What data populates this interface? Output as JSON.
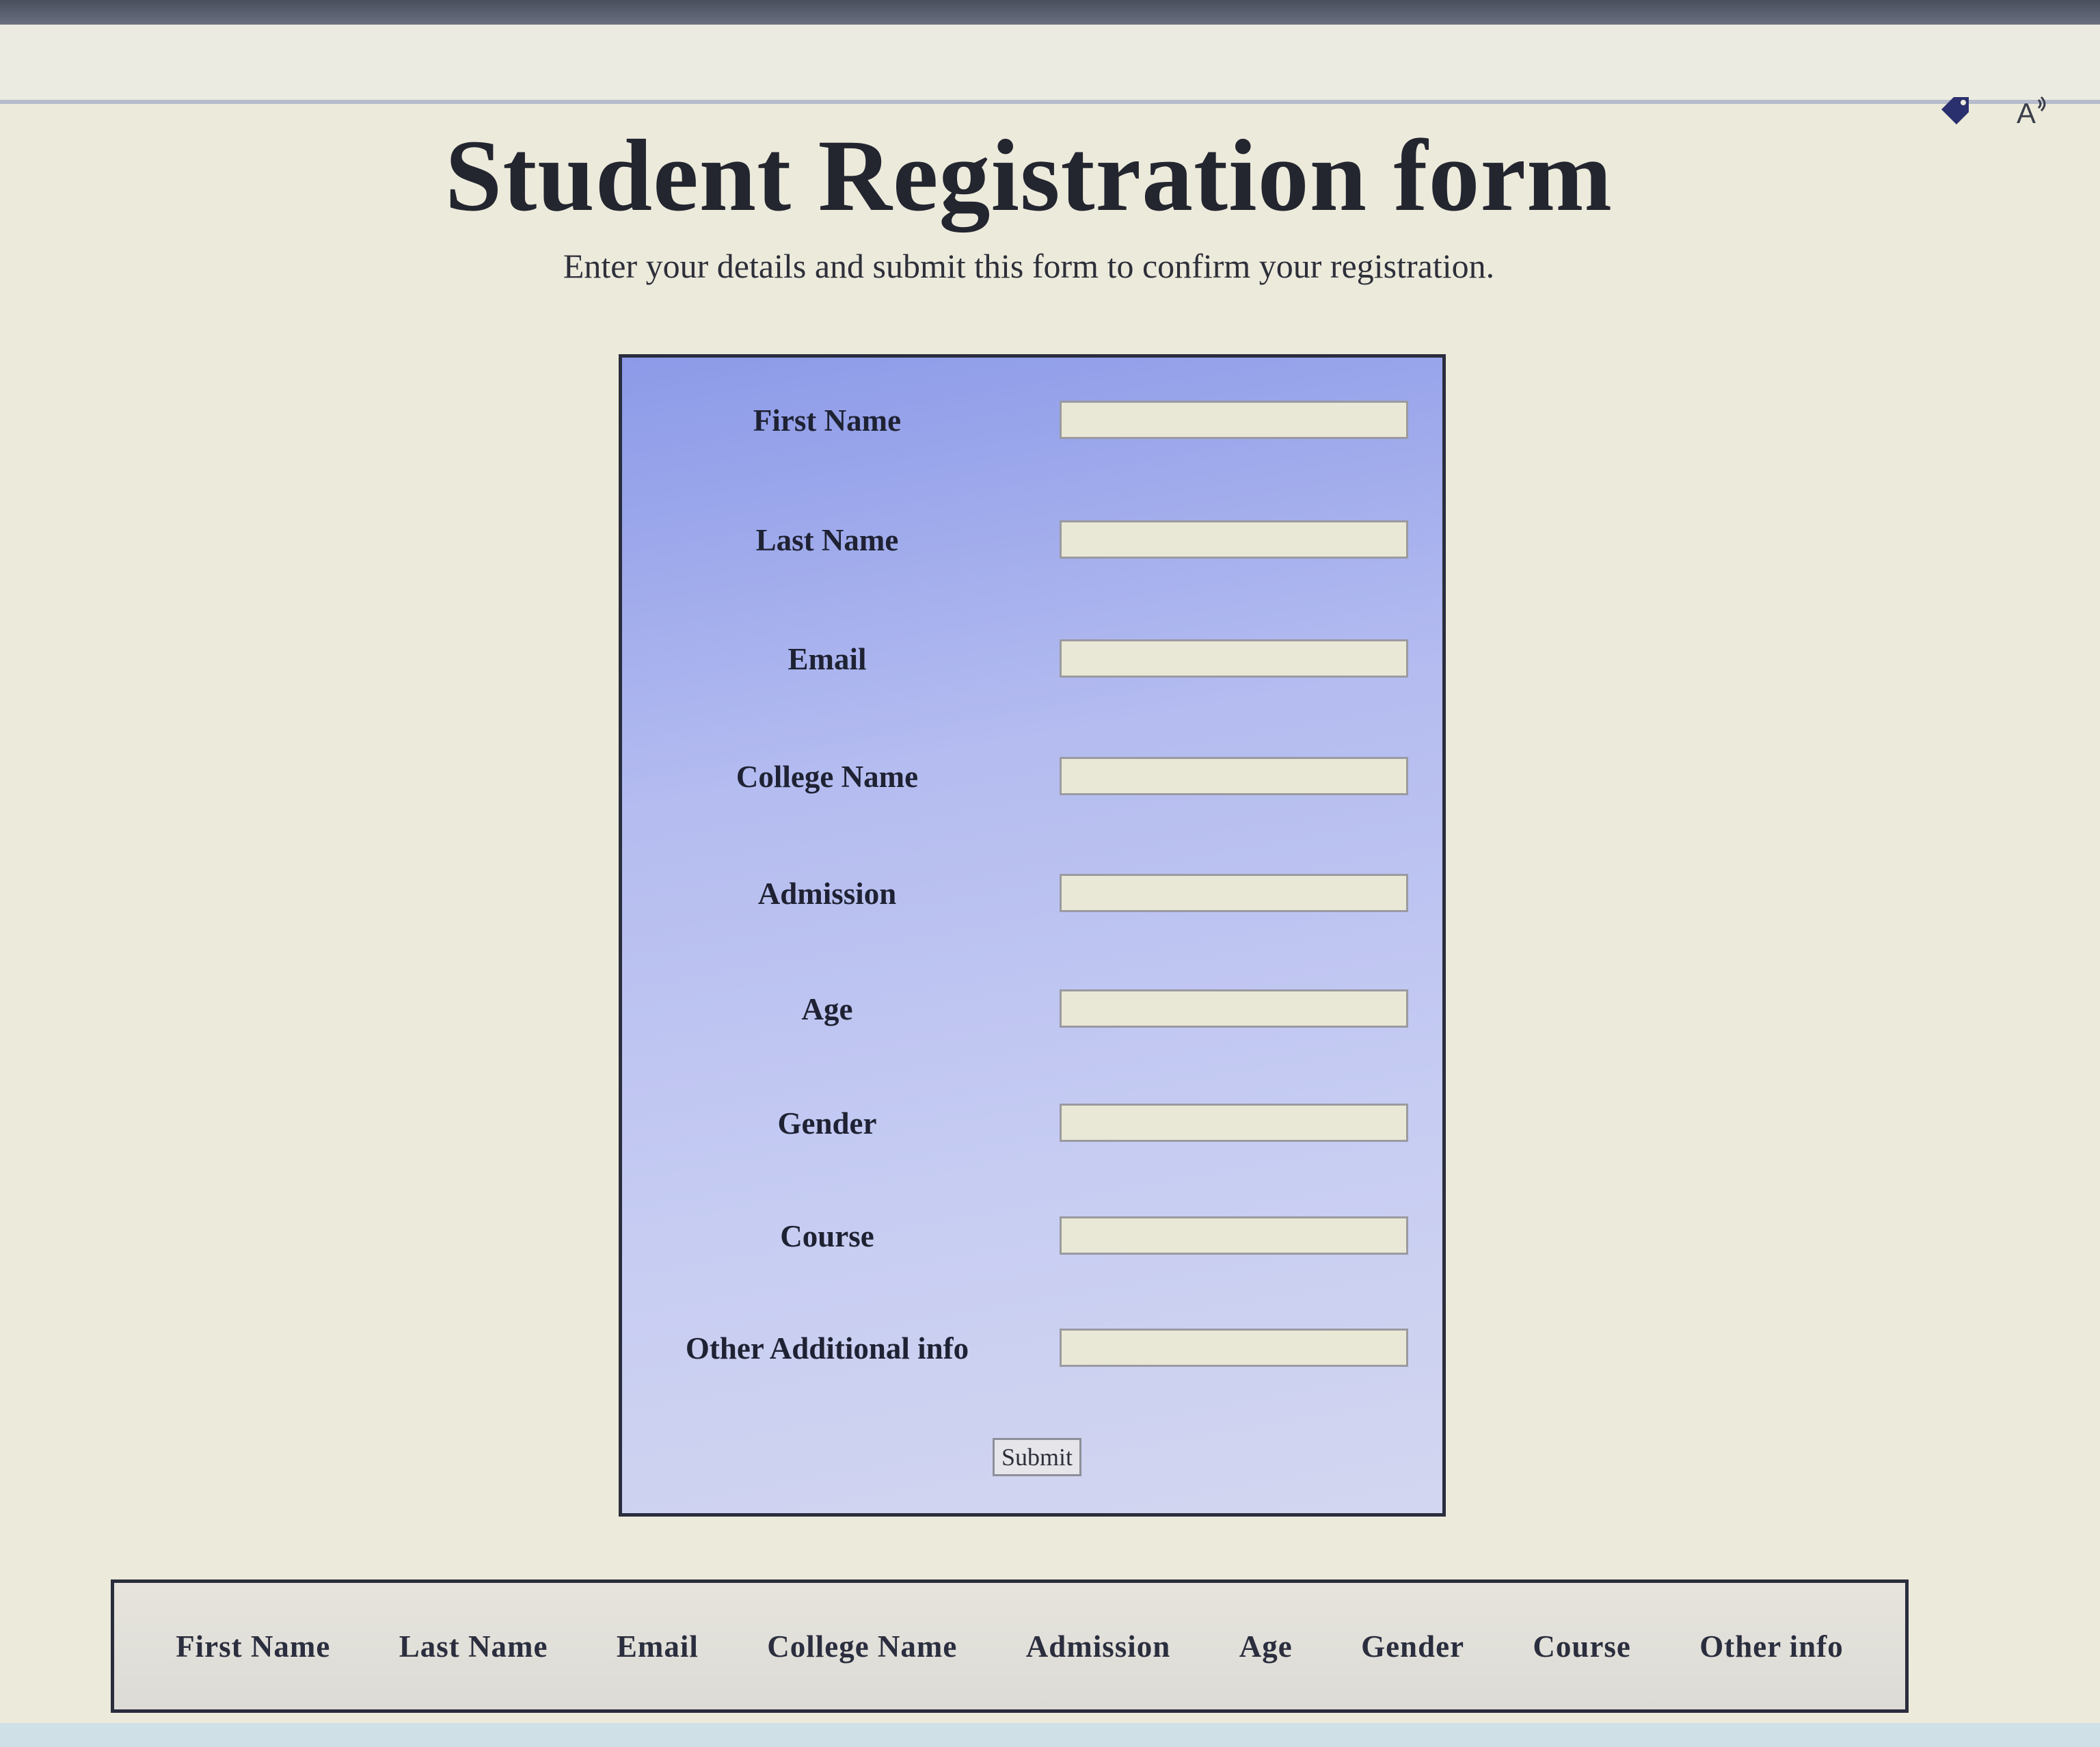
{
  "page": {
    "title": "Student Registration form",
    "subtitle": "Enter your details and submit this form to confirm your registration."
  },
  "toolbar": {
    "icons": [
      "tag-icon",
      "read-aloud-icon"
    ],
    "read_aloud_label": "A"
  },
  "form": {
    "fields": [
      {
        "label": "First Name",
        "value": ""
      },
      {
        "label": "Last Name",
        "value": ""
      },
      {
        "label": "Email",
        "value": ""
      },
      {
        "label": "College Name",
        "value": ""
      },
      {
        "label": "Admission",
        "value": ""
      },
      {
        "label": "Age",
        "value": ""
      },
      {
        "label": "Gender",
        "value": ""
      },
      {
        "label": "Course",
        "value": ""
      },
      {
        "label": "Other Additional info",
        "value": ""
      }
    ],
    "submit_label": "Submit"
  },
  "table": {
    "headers": [
      "First Name",
      "Last Name",
      "Email",
      "College Name",
      "Admission",
      "Age",
      "Gender",
      "Course",
      "Other info"
    ]
  },
  "colors": {
    "page_background": "#eceadb",
    "panel_gradient_top": "#8c9ae8",
    "panel_gradient_bottom": "#d3d6f0",
    "input_background": "#e9e8d6",
    "border": "#2a2d3c"
  }
}
